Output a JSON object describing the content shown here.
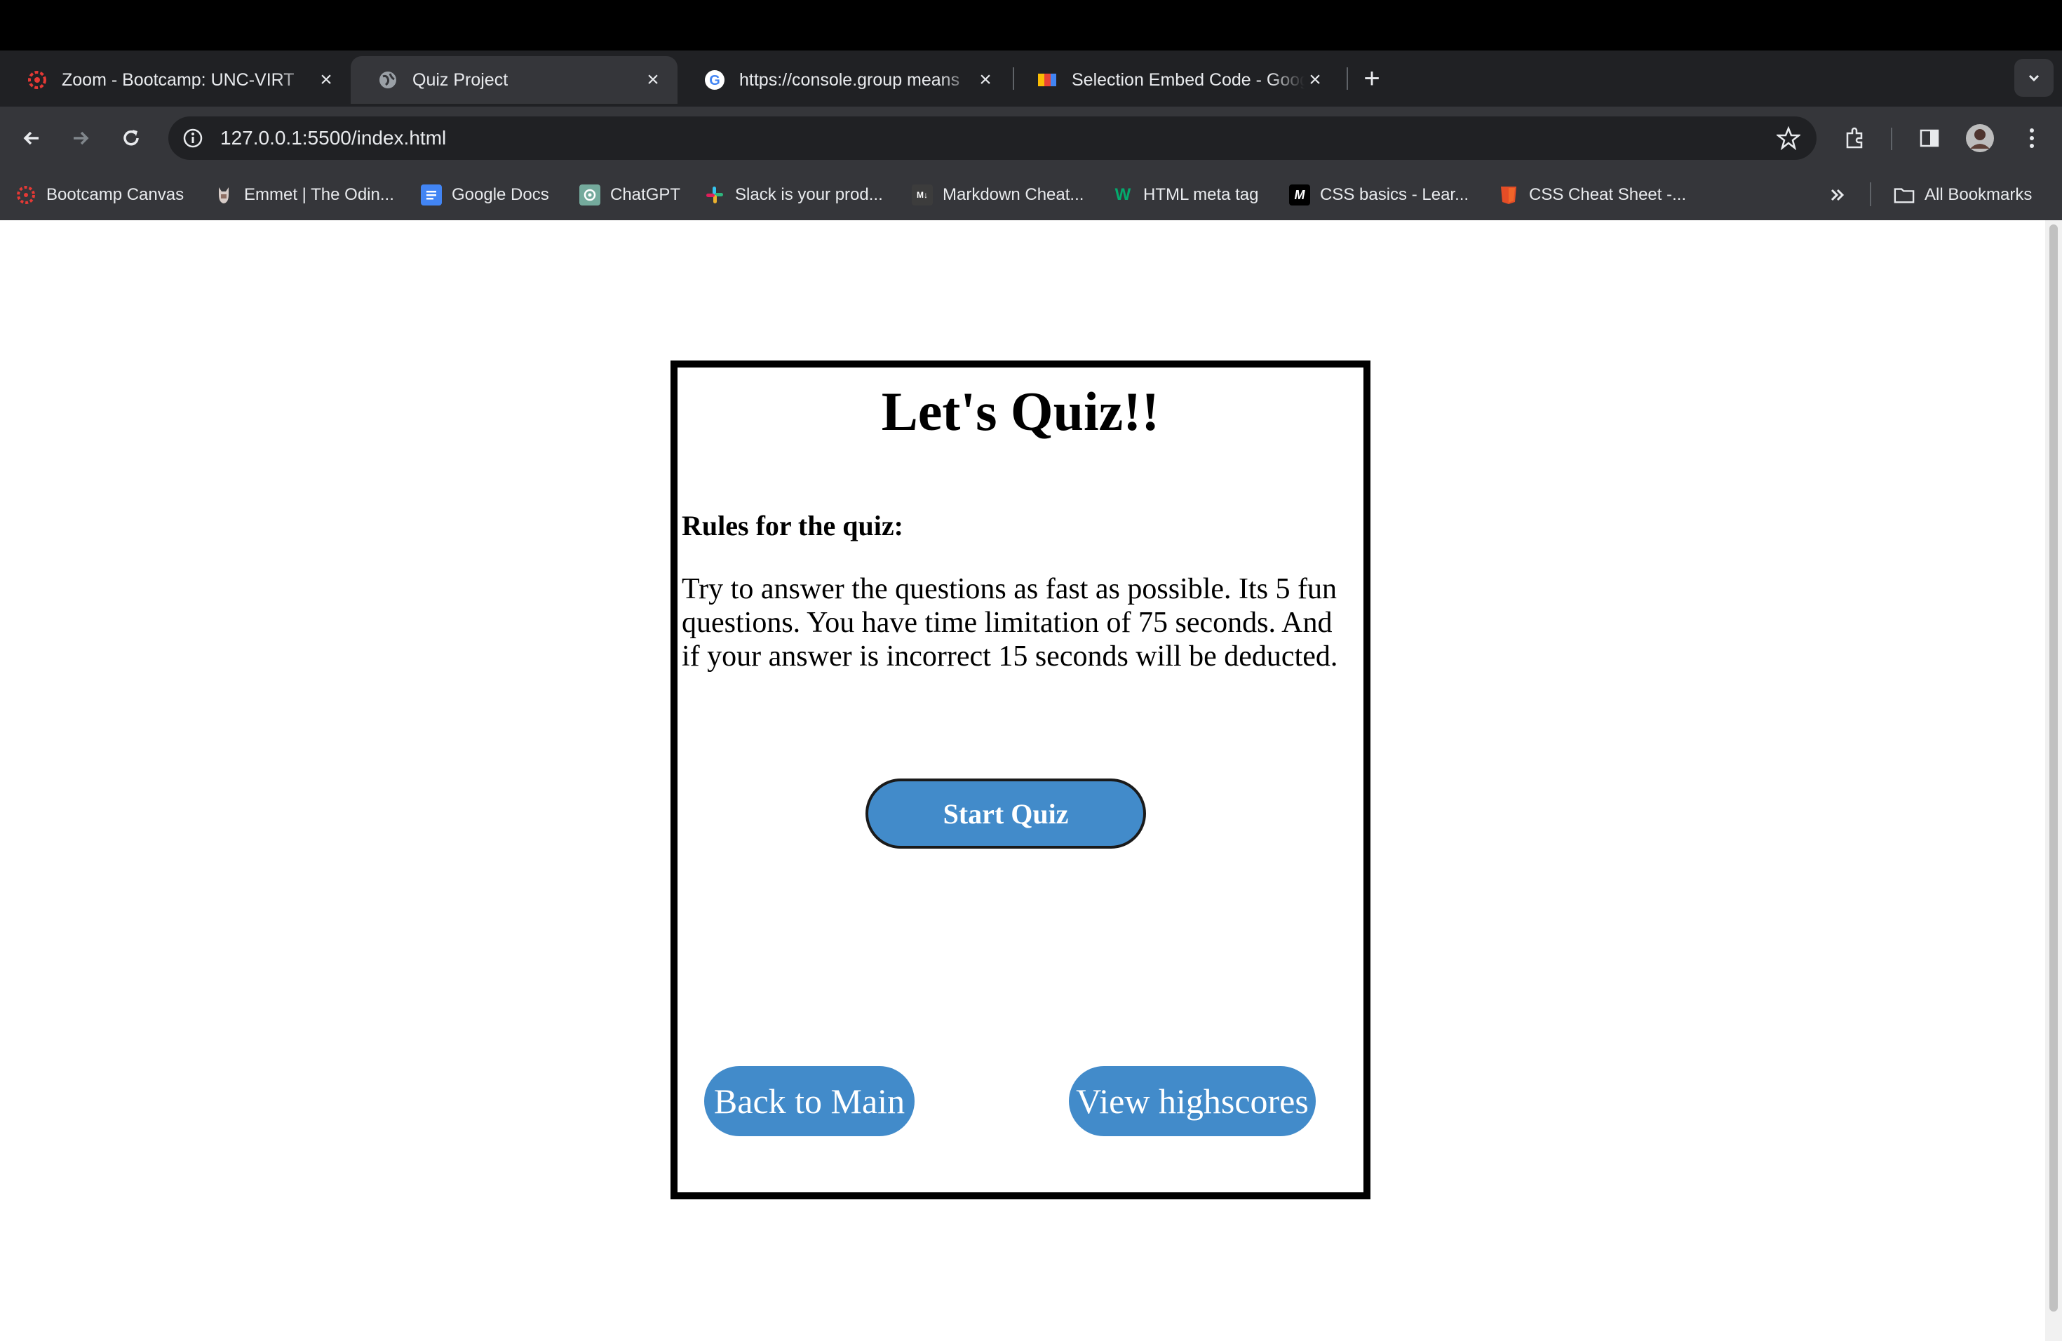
{
  "browser": {
    "tabs": [
      {
        "title": "Zoom - Bootcamp: UNC-VIRT",
        "favicon": "zoom-icon",
        "active": false
      },
      {
        "title": "Quiz Project",
        "favicon": "globe-icon",
        "active": true
      },
      {
        "title": "https://console.group means",
        "favicon": "google-icon",
        "active": false
      },
      {
        "title": "Selection Embed Code - Goog",
        "favicon": "embed-icon",
        "active": false
      }
    ],
    "url": "127.0.0.1:5500/index.html",
    "bookmarks": [
      {
        "label": "Bootcamp Canvas",
        "icon": "canvas-icon"
      },
      {
        "label": "Emmet | The Odin...",
        "icon": "odin-icon"
      },
      {
        "label": "Google Docs",
        "icon": "docs-icon"
      },
      {
        "label": "ChatGPT",
        "icon": "chatgpt-icon"
      },
      {
        "label": "Slack is your prod...",
        "icon": "slack-icon"
      },
      {
        "label": "Markdown Cheat...",
        "icon": "markdown-icon"
      },
      {
        "label": "HTML meta tag",
        "icon": "w3-icon"
      },
      {
        "label": "CSS basics - Lear...",
        "icon": "mdn-icon"
      },
      {
        "label": "CSS Cheat Sheet -...",
        "icon": "html5-icon"
      }
    ],
    "all_bookmarks_label": "All Bookmarks",
    "colors": {
      "tabstrip": "#202124",
      "toolbar": "#35363a",
      "text": "#e8eaed"
    }
  },
  "quiz": {
    "title": "Let's Quiz!!",
    "rules_heading": "Rules for the quiz:",
    "rules_text": "Try to answer the questions as fast as possible. Its 5 fun questions. You have time limitation of 75 seconds. And if your answer is incorrect 15 seconds will be deducted.",
    "start_label": "Start Quiz",
    "back_label": "Back to Main",
    "highscores_label": "View highscores",
    "button_color": "#428bca"
  }
}
